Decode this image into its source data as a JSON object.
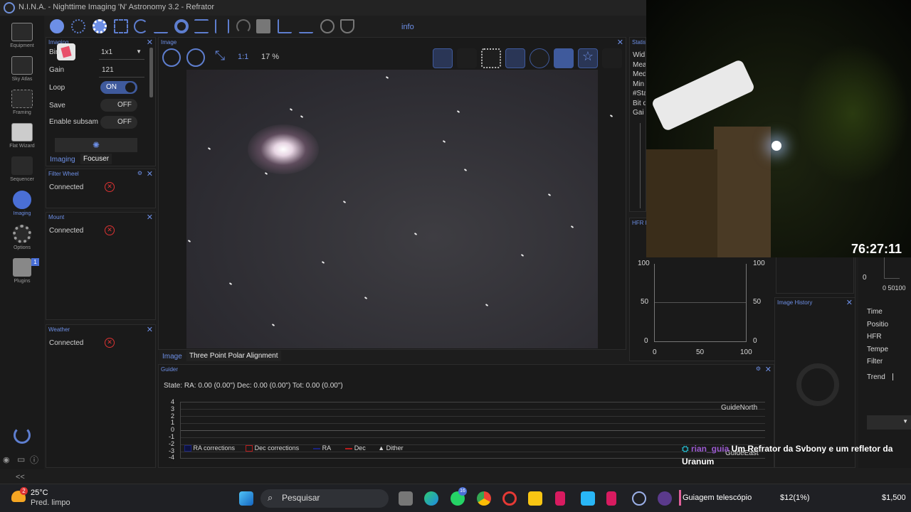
{
  "window": {
    "title": "N.I.N.A. - Nighttime Imaging 'N' Astronomy 3.2  -  Refrator"
  },
  "nav": [
    {
      "label": "Equipment",
      "icon": "camera-icon"
    },
    {
      "label": "Sky Atlas",
      "icon": "atlas-icon"
    },
    {
      "label": "Framing",
      "icon": "framing-icon"
    },
    {
      "label": "Flat Wizard",
      "icon": "flat-wizard-icon"
    },
    {
      "label": "Sequencer",
      "icon": "sequencer-icon"
    },
    {
      "label": "Imaging",
      "icon": "imaging-icon",
      "active": true
    },
    {
      "label": "Options",
      "icon": "gear-icon"
    },
    {
      "label": "Plugins",
      "icon": "puzzle-icon",
      "badge": "1"
    }
  ],
  "toolbar": {
    "info_label": "info"
  },
  "imaging_panel": {
    "title": "Imaging",
    "bin_label": "Bin",
    "bin_value": "1x1",
    "gain_label": "Gain",
    "gain_value": "121",
    "loop_label": "Loop",
    "loop_value": "ON",
    "save_label": "Save",
    "save_value": "OFF",
    "subsample_label": "Enable subsam",
    "subsample_value": "OFF",
    "tabs": [
      "Imaging",
      "Focuser"
    ]
  },
  "filter_wheel": {
    "title": "Filter Wheel",
    "status_label": "Connected"
  },
  "mount": {
    "title": "Mount",
    "status_label": "Connected"
  },
  "weather": {
    "title": "Weather",
    "status_label": "Connected"
  },
  "image_panel": {
    "title": "Image",
    "zoom": "17 %",
    "one_to_one": "1:1",
    "tabs": [
      "Image",
      "Three Point Polar Alignment"
    ]
  },
  "statistics": {
    "title": "Statisti",
    "rows": [
      "Wid",
      "Mea",
      "Med",
      "Min",
      "#Sta",
      "Bit d",
      "Gai"
    ]
  },
  "hfr_panel": {
    "title": "HFR h",
    "y_ticks_left": [
      "100",
      "50",
      "0"
    ],
    "y_ticks_right": [
      "100",
      "50",
      "0"
    ],
    "x_ticks": [
      "0",
      "50",
      "100"
    ]
  },
  "image_history": {
    "title": "Image History"
  },
  "right_col": {
    "zero": "0",
    "axis": "0 50100",
    "rows": [
      "Time",
      "Positio",
      "HFR",
      "Tempe",
      "Filter"
    ],
    "trend": "Trend"
  },
  "guider": {
    "title": "Guider",
    "state": "State:  RA: 0.00 (0.00\")  Dec: 0.00 (0.00\")  Tot: 0.00 (0.00\")",
    "y_ticks": [
      "4",
      "3",
      "2",
      "1",
      "0",
      "-1",
      "-2",
      "-3",
      "-4"
    ],
    "north_label": "GuideNorth",
    "east_label": "GuideEast",
    "legend": [
      "RA corrections",
      "Dec corrections",
      "RA",
      "Dec",
      "Dither"
    ]
  },
  "stream": {
    "timer": "76:27:11",
    "user": "rian_guia",
    "message": "Um Refrator da Svbony e um refletor da Uranum"
  },
  "taskbar": {
    "temp": "25°C",
    "weather": "Pred. limpo",
    "weather_badge": "2",
    "search_placeholder": "Pesquisar",
    "whatsapp_badge": "16",
    "window_label": "Guiagem telescópio",
    "ticker_1": "$12(1%)",
    "ticker_2": "$1,500"
  },
  "colors": {
    "accent": "#6d8fe6",
    "error": "#dd3333",
    "panel_bg": "#1a1a1a"
  }
}
